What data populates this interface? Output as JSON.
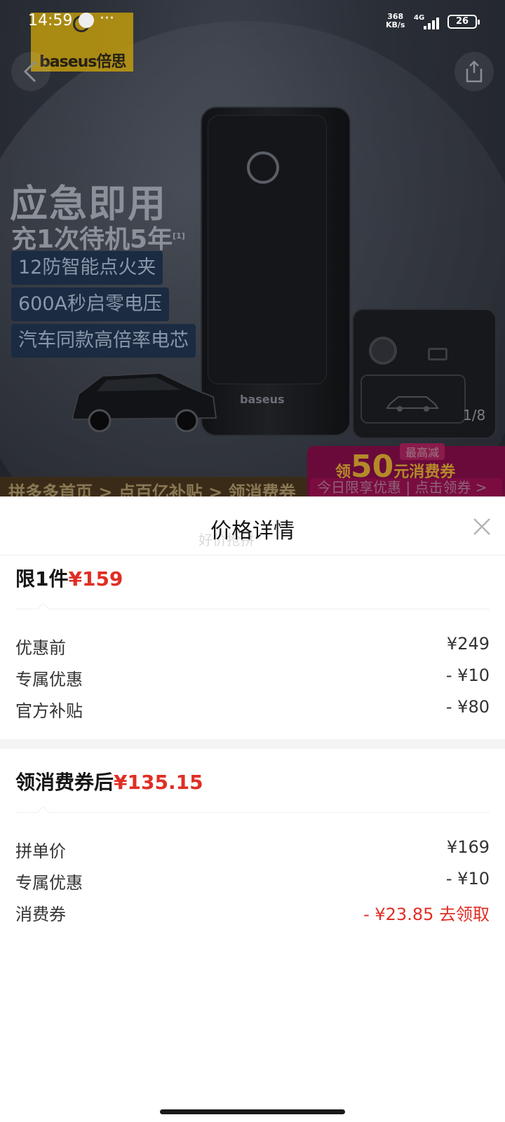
{
  "status_bar": {
    "time": "14:59",
    "dots": "···",
    "net_speed_value": "368",
    "net_speed_unit": "KB/s",
    "network": "4G",
    "battery": "26"
  },
  "banner": {
    "brand": "baseus倍思",
    "slogan_line1": "应急即用",
    "slogan_line2": "充1次待机5年",
    "slogan_footnote": "[1]",
    "features": [
      "12防智能点火夹",
      "600A秒启零电压",
      "汽车同款高倍率电芯"
    ],
    "device_brand": "baseus",
    "pager": "1/8",
    "promo": {
      "prefix": "领",
      "amount": "50",
      "suffix": "元消费券",
      "badge": "最高减",
      "bottom": "今日限享优惠 | 点击领券 >"
    },
    "nav_strip": "拼多多首页 > 点百亿补贴 > 领消费券"
  },
  "sheet": {
    "title": "价格详情",
    "ghost_text": "好价抢拼",
    "section1": {
      "title": "限1件",
      "price": "¥159",
      "rows": [
        {
          "label": "优惠前",
          "value": "¥249"
        },
        {
          "label": "专属优惠",
          "value": "- ¥10"
        },
        {
          "label": "官方补贴",
          "value": "- ¥80"
        }
      ]
    },
    "section2": {
      "title": "领消费券后",
      "price": "¥135.15",
      "rows": [
        {
          "label": "拼单价",
          "value": "¥169"
        },
        {
          "label": "专属优惠",
          "value": "- ¥10"
        },
        {
          "label": "消费券",
          "value": "- ¥23.85 去领取"
        }
      ]
    }
  },
  "colors": {
    "accent_red": "#e02e24",
    "text_primary": "#151515",
    "text_secondary": "#333333",
    "divider": "#efefef",
    "section_gap": "#f4f4f4"
  },
  "icons": {
    "back": "chevron-left-icon",
    "share": "share-icon",
    "close": "close-icon"
  }
}
